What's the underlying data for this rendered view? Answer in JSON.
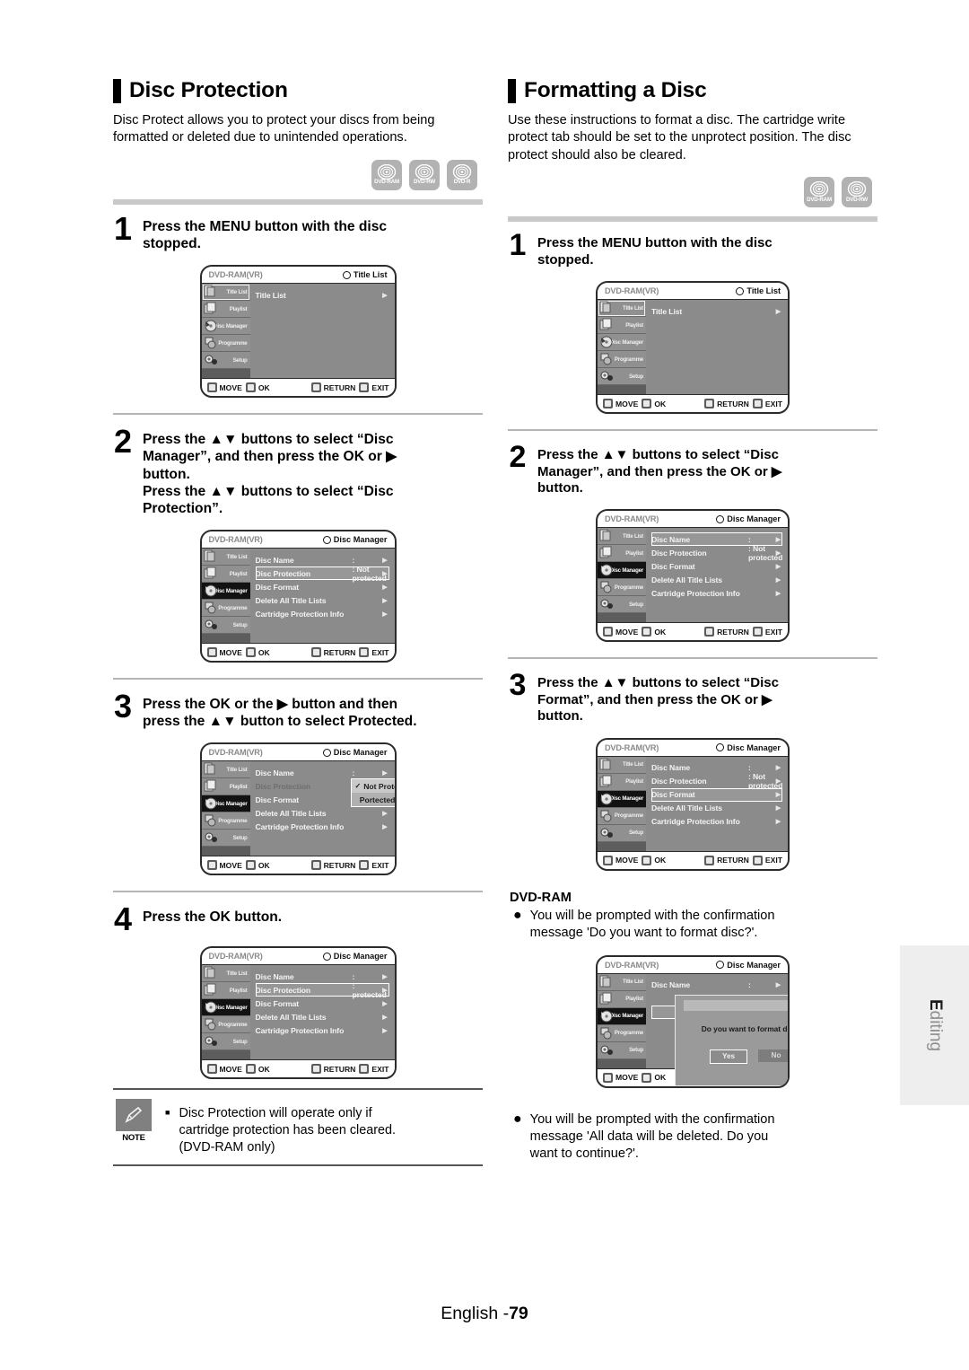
{
  "page": {
    "footer_label": "English -",
    "footer_page": "79",
    "side_tab_first": "E",
    "side_tab_rest": "diting"
  },
  "left_section": {
    "title": "Disc Protection",
    "intro": [
      "Disc Protect allows you to protect your discs from being",
      "formatted or deleted due to unintended operations."
    ],
    "discs": [
      "DVD-RAM",
      "DVD-RW",
      "DVD-R"
    ],
    "steps": [
      {
        "num": "1",
        "lines": [
          "Press the MENU button with the disc",
          "stopped."
        ]
      },
      {
        "num": "2",
        "lines": [
          "Press the ▲▼ buttons to select “Disc",
          "Manager”, and then press the OK or ▶",
          "button.",
          "Press the ▲▼ buttons to select “Disc",
          "Protection”."
        ]
      },
      {
        "num": "3",
        "lines": [
          "Press the OK or the ▶ button and then",
          "press the ▲▼ button to select Protected."
        ]
      },
      {
        "num": "4",
        "lines": [
          "Press the OK button."
        ]
      }
    ],
    "note": {
      "badge_label": "NOTE",
      "icon": "pencil-icon",
      "bullet": "■",
      "lines": [
        "Disc Protection will operate only if",
        "cartridge protection has been cleared.",
        "(DVD-RAM only)"
      ]
    }
  },
  "right_section": {
    "title": "Formatting a Disc",
    "intro": [
      "Use these instructions to format a disc. The cartridge",
      "write protect tab should be set to the unprotect position.",
      "The disc protect should also be cleared."
    ],
    "discs": [
      "DVD-RAM",
      "DVD-RW"
    ],
    "steps": [
      {
        "num": "1",
        "lines": [
          "Press the MENU button with the disc",
          "stopped."
        ]
      },
      {
        "num": "2",
        "lines": [
          "Press the ▲▼ buttons to select “Disc",
          "Manager”, and then press the OK or ▶",
          "button."
        ]
      },
      {
        "num": "3",
        "lines": [
          "Press the ▲▼ buttons to select “Disc",
          "Format”, and then press the OK or ▶",
          "button."
        ]
      }
    ],
    "dvd_ram_head": "DVD-RAM",
    "bullets": [
      {
        "lines": [
          "You will be prompted with the confirmation",
          "message 'Do you want to format disc?'."
        ]
      },
      {
        "lines": [
          "You will be prompted with the confirmation",
          "message 'All data will be deleted. Do you",
          "want to continue?'."
        ]
      }
    ]
  },
  "tv_menu": {
    "source": "DVD-RAM(VR)",
    "title_title_list": "Title List",
    "title_disc_manager": "Disc Manager",
    "sidebar": [
      "Title List",
      "Playlist",
      "Disc Manager",
      "Programme",
      "Setup"
    ],
    "footbar": [
      {
        "key": "updown-key-icon",
        "label": "MOVE"
      },
      {
        "key": "ok-key-icon",
        "label": "OK"
      },
      {
        "key": "return-key-icon",
        "label": "RETURN"
      },
      {
        "key": "exit-key-icon",
        "label": "EXIT"
      }
    ],
    "title_list_rows": [
      {
        "label": "Title List",
        "value": "",
        "arrow": "▶"
      }
    ],
    "disc_manager_rows": [
      {
        "label": "Disc Name",
        "value": ":",
        "arrow": "▶"
      },
      {
        "label": "Disc Protection",
        "value": ": Not protected",
        "arrow": "▶"
      },
      {
        "label": "Disc Format",
        "value": "",
        "arrow": "▶"
      },
      {
        "label": "Delete All Title Lists",
        "value": "",
        "arrow": "▶"
      },
      {
        "label": "Cartridge Protection Info",
        "value": "",
        "arrow": "▶"
      }
    ],
    "protected_row_value": ": protected",
    "dropdown": {
      "checked_mark": "✓",
      "options": [
        "Not Protected",
        "Portected"
      ]
    },
    "dialog": {
      "message": "Do you want to format disc?",
      "yes": "Yes",
      "no": "No"
    }
  }
}
